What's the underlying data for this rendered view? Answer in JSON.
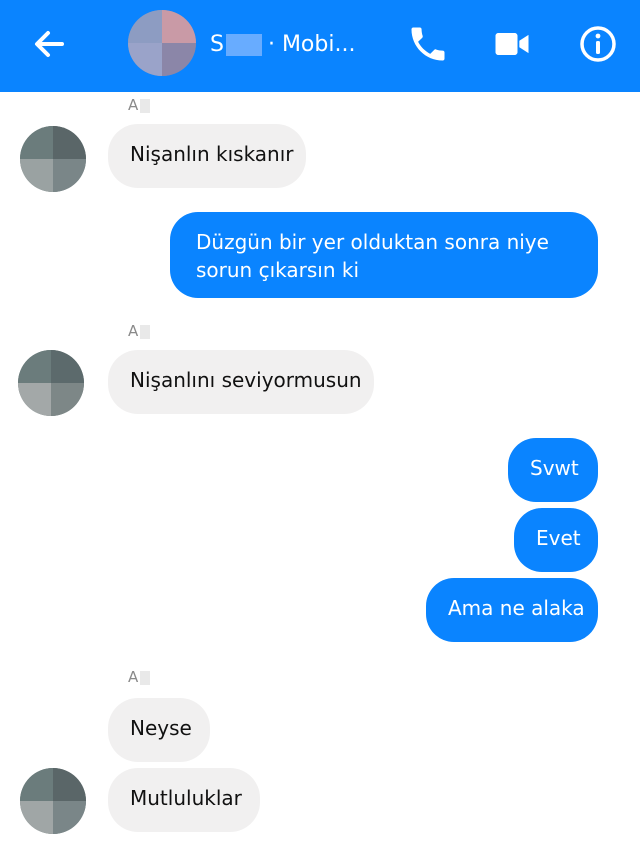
{
  "header": {
    "title_prefix": "S",
    "title_suffix": "· Mobi...",
    "icons": [
      "back-arrow-icon",
      "avatar",
      "phone-icon",
      "video-camera-icon",
      "info-icon"
    ],
    "color": "#0a84ff"
  },
  "sender_initial": "A",
  "messages": {
    "m1": "Nişanlın kıskanır",
    "m2": "Düzgün bir yer olduktan sonra niye sorun çıkarsın ki",
    "m3": "Nişanlını seviyormusun",
    "m4": "Svwt",
    "m5": "Evet",
    "m6": "Ama ne alaka",
    "m7": "Neyse",
    "m8": "Mutluluklar"
  },
  "colors": {
    "incoming_bubble": "#f1f0f0",
    "outgoing_bubble": "#0a84ff"
  }
}
